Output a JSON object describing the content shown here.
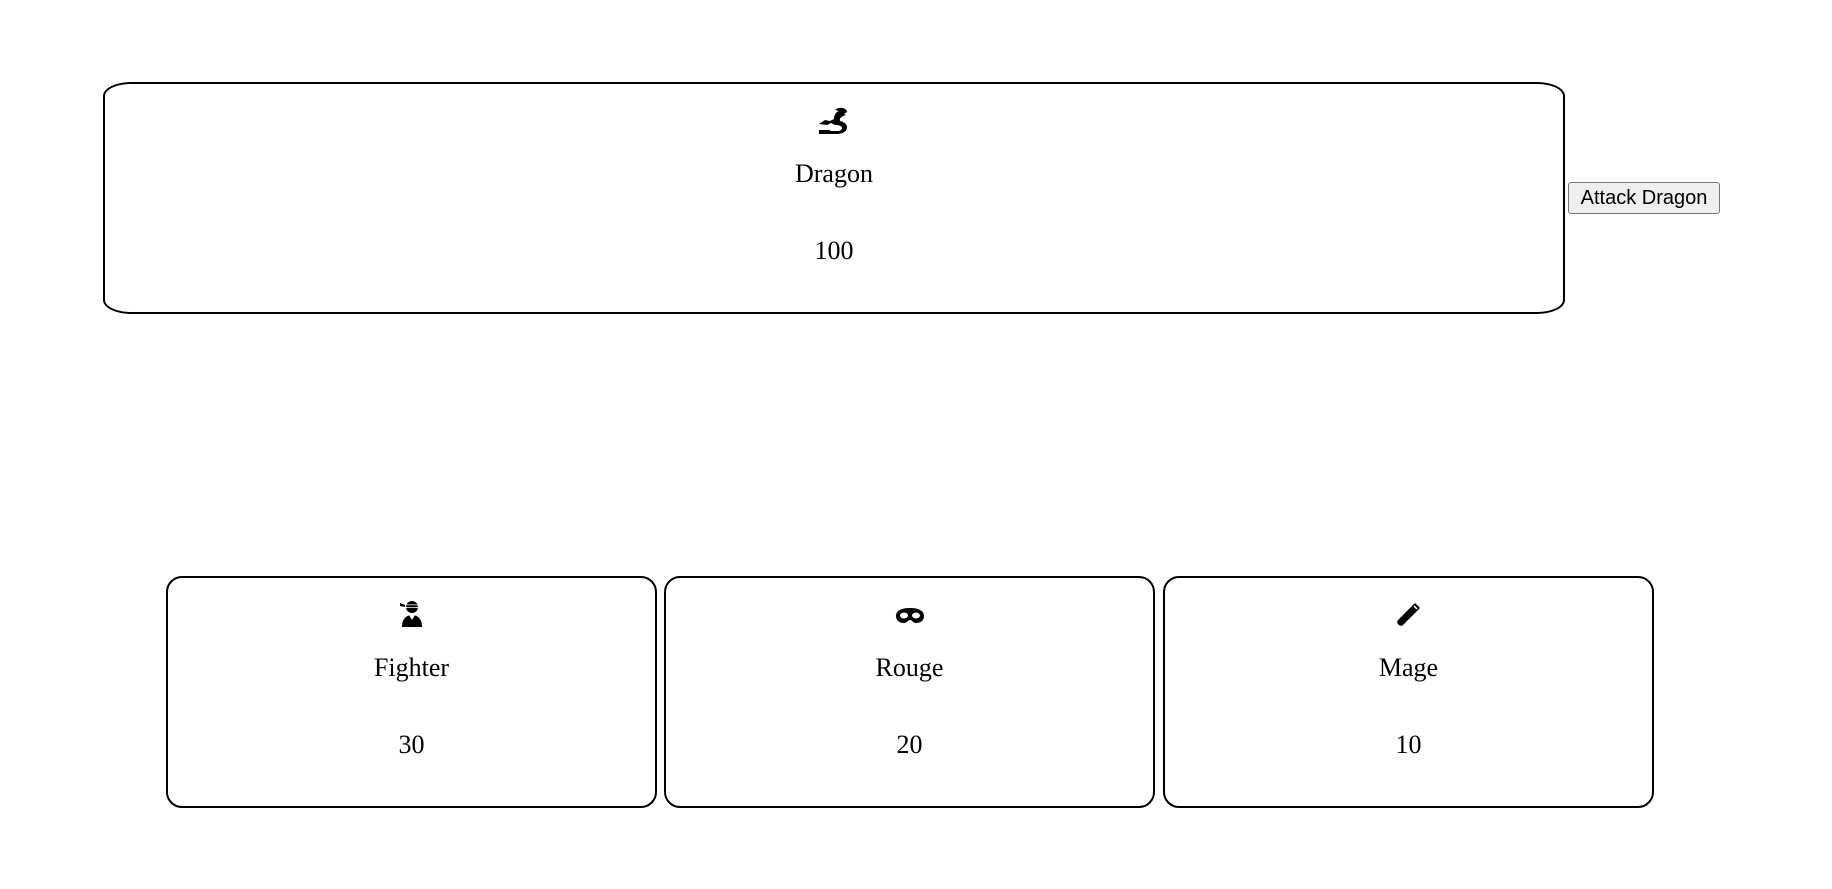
{
  "boss": {
    "icon": "dragon-icon",
    "name": "Dragon",
    "hp": "100"
  },
  "actions": {
    "attack_label": "Attack Dragon"
  },
  "heroes": [
    {
      "icon": "user-ninja-icon",
      "name": "Fighter",
      "hp": "30"
    },
    {
      "icon": "mask-icon",
      "name": "Rouge",
      "hp": "20"
    },
    {
      "icon": "wand-icon",
      "name": "Mage",
      "hp": "10"
    }
  ]
}
